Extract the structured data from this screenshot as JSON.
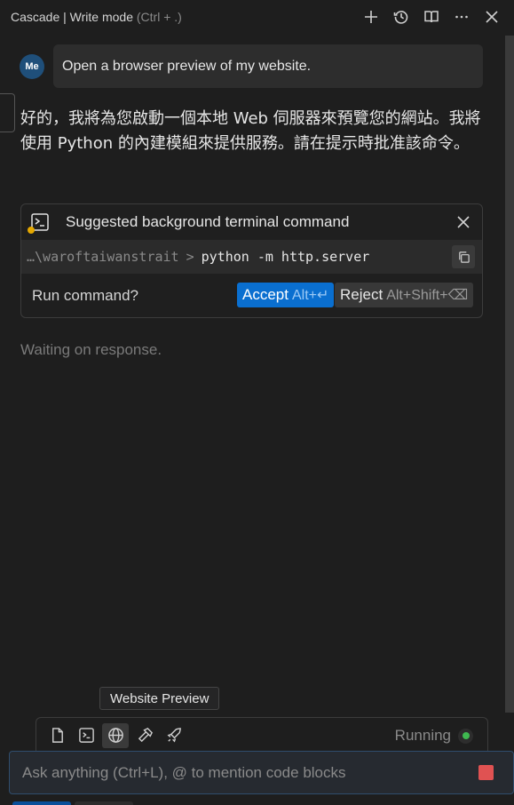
{
  "header": {
    "title": "Cascade | Write mode",
    "shortcut_hint": "(Ctrl + .)",
    "actions": [
      "plus-icon",
      "history-icon",
      "book-open-icon",
      "more-icon",
      "close-icon"
    ]
  },
  "conversation": {
    "user": {
      "avatar_initials": "Me",
      "message": "Open a browser preview of my website."
    },
    "assistant_message": "好的，我將為您啟動一個本地 Web 伺服器來預覽您的網站。我將使用 Python 的內建模組來提供服務。請在提示時批准該命令。",
    "command_card": {
      "title": "Suggested background terminal command",
      "path": "…\\waroftaiwanstrait",
      "prompt_sep": ">",
      "command": "python -m http.server",
      "question": "Run command?",
      "accept_label": "Accept",
      "accept_shortcut": "Alt+↵",
      "reject_label": "Reject",
      "reject_shortcut": "Alt+Shift+⌫"
    },
    "waiting_text": "Waiting on response."
  },
  "toolbar": {
    "tooltip": "Website Preview",
    "tools": [
      "file-icon",
      "terminal-icon",
      "globe-icon",
      "hammer-icon",
      "rocket-icon"
    ],
    "active_tool": "globe-icon",
    "status_label": "Running",
    "status_color": "#3fb950"
  },
  "input": {
    "placeholder": "Ask anything (Ctrl+L), @ to mention code blocks"
  },
  "colors": {
    "accent": "#0a6fd0",
    "stop": "#e05252",
    "warning_dot": "#e5a800"
  }
}
